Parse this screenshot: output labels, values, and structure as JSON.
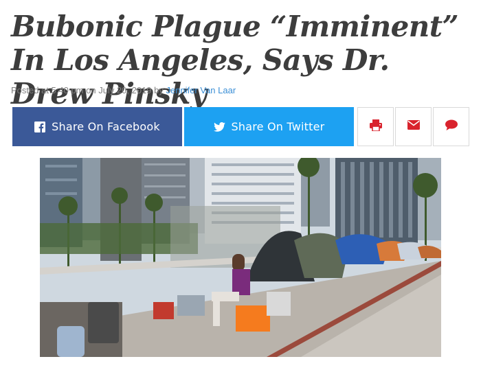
{
  "article": {
    "title": "Bubonic Plague “Imminent” In Los Angeles, Says Dr. Drew Pinsky",
    "byline_prefix": "Posted at 5:40 pm on July 20, 2019 by ",
    "author": "Jennifer Van Laar"
  },
  "share": {
    "facebook_label": "Share On Facebook",
    "twitter_label": "Share On Twitter",
    "facebook_icon": "facebook-icon",
    "twitter_icon": "twitter-icon",
    "print_icon": "print-icon",
    "email_icon": "email-icon",
    "comment_icon": "comment-icon"
  },
  "colors": {
    "facebook": "#3b5998",
    "twitter": "#1da1f2",
    "icon_red": "#d9232d",
    "headline": "#3d3d3d",
    "link": "#3b8fd6"
  }
}
